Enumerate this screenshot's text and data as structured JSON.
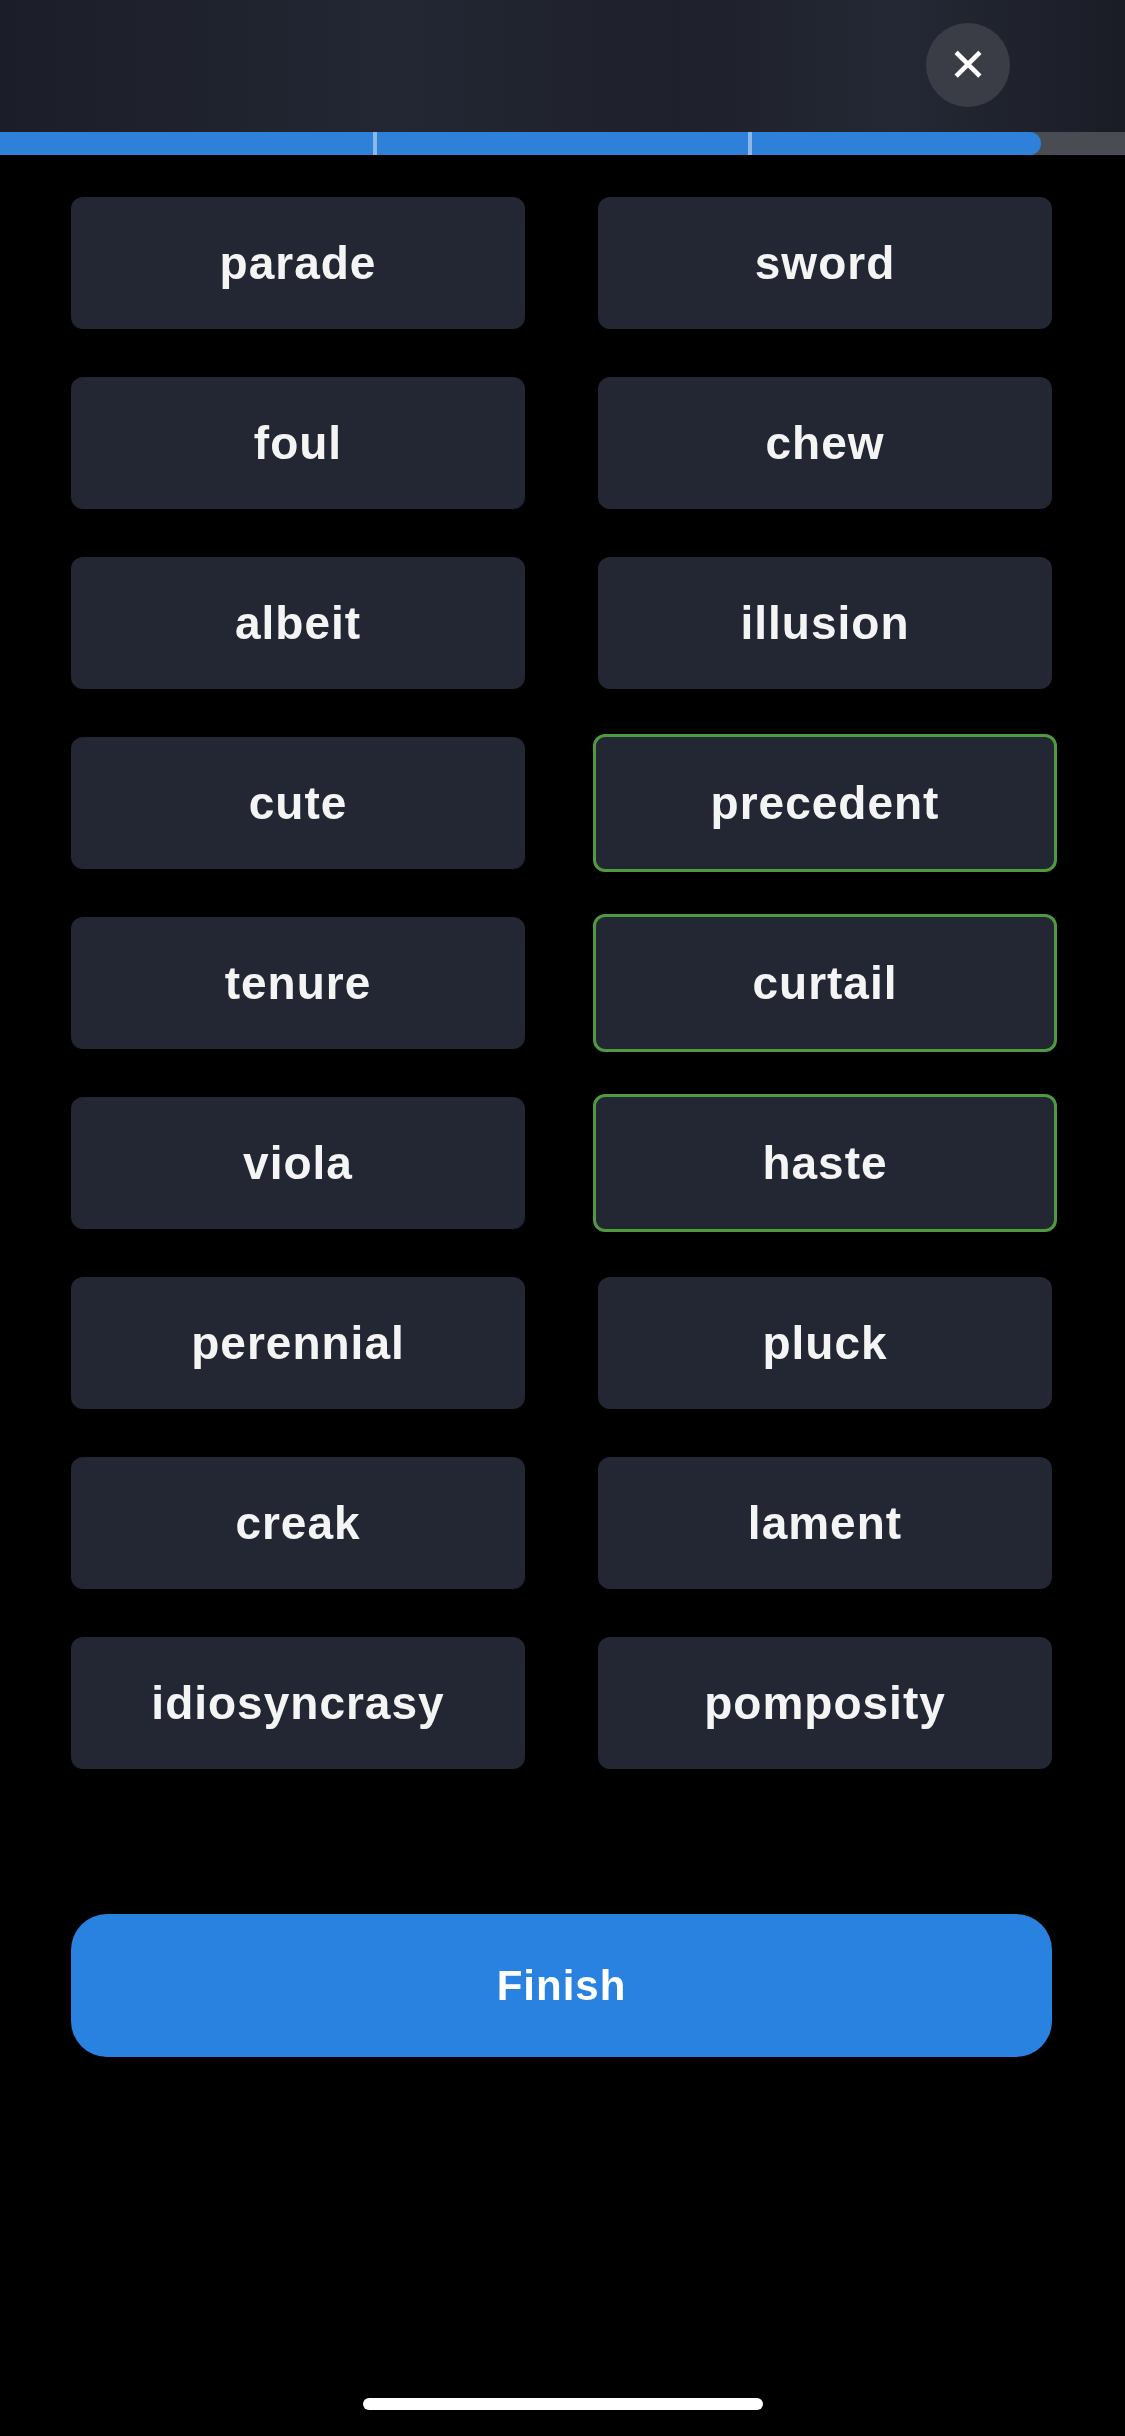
{
  "close_button": {
    "label": "✕"
  },
  "progress": {
    "level": 0.925
  },
  "words": [
    {
      "text": "parade",
      "selected": false
    },
    {
      "text": "sword",
      "selected": false
    },
    {
      "text": "foul",
      "selected": false
    },
    {
      "text": "chew",
      "selected": false
    },
    {
      "text": "albeit",
      "selected": false
    },
    {
      "text": "illusion",
      "selected": false
    },
    {
      "text": "cute",
      "selected": false
    },
    {
      "text": "precedent",
      "selected": true
    },
    {
      "text": "tenure",
      "selected": false
    },
    {
      "text": "curtail",
      "selected": true
    },
    {
      "text": "viola",
      "selected": false
    },
    {
      "text": "haste",
      "selected": true
    },
    {
      "text": "perennial",
      "selected": false
    },
    {
      "text": "pluck",
      "selected": false
    },
    {
      "text": "creak",
      "selected": false
    },
    {
      "text": "lament",
      "selected": false
    },
    {
      "text": "idiosyncrasy",
      "selected": false
    },
    {
      "text": "pomposity",
      "selected": false
    }
  ],
  "finish_button": {
    "label": "Finish"
  }
}
